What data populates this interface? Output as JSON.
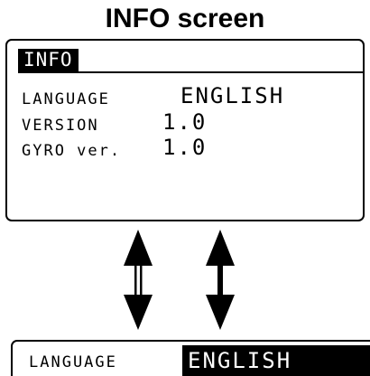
{
  "title": "INFO screen",
  "screen": {
    "header": "INFO",
    "rows": [
      {
        "label": "LANGUAGE",
        "value": "ENGLISH"
      },
      {
        "label": "VERSION",
        "value": "1.0"
      },
      {
        "label": "GYRO ver.",
        "value": "1.0"
      }
    ]
  },
  "detail": {
    "label": "LANGUAGE",
    "value": "ENGLISH"
  },
  "icons": {
    "left_arrow": "double-line-up-down-arrow-icon",
    "right_arrow": "up-down-arrow-icon"
  }
}
